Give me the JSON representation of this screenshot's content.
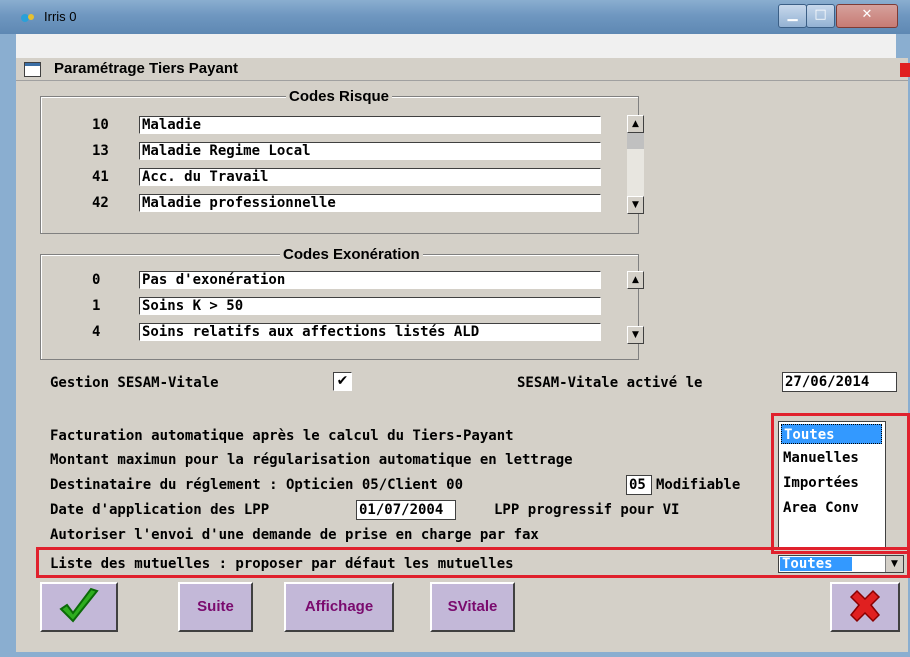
{
  "window": {
    "title": "Irris 0"
  },
  "dialog": {
    "title": "Paramétrage Tiers Payant"
  },
  "codes_risque": {
    "title": "Codes Risque",
    "items": [
      {
        "code": "10",
        "label": "Maladie"
      },
      {
        "code": "13",
        "label": "Maladie Regime Local"
      },
      {
        "code": "41",
        "label": "Acc. du Travail"
      },
      {
        "code": "42",
        "label": "Maladie professionnelle"
      }
    ]
  },
  "codes_exoneration": {
    "title": "Codes Exonération",
    "items": [
      {
        "code": "0",
        "label": "Pas d'exonération"
      },
      {
        "code": "1",
        "label": "Soins K > 50"
      },
      {
        "code": "4",
        "label": "Soins relatifs aux affections listés ALD"
      }
    ]
  },
  "sesam": {
    "label": "Gestion SESAM-Vitale",
    "checked": "✔",
    "active_label": "SESAM-Vitale activé le",
    "active_date": "27/06/2014"
  },
  "settings": {
    "line1": "Facturation automatique après le calcul du Tiers-Payant",
    "line2": "Montant maximun pour la régularisation automatique en lettrage",
    "line3_prefix": "Destinataire du réglement : Opticien 05/Client 00",
    "line3_value": "05",
    "line3_suffix": "Modifiable",
    "line4_prefix": "Date d'application des LPP",
    "line4_date": "01/07/2004",
    "line4_suffix": "LPP progressif pour VI",
    "line5": "Autoriser l'envoi d'une demande de prise en charge par fax",
    "line6": "Liste des mutuelles : proposer par défaut les mutuelles"
  },
  "listbox": {
    "options": [
      "Toutes",
      "Manuelles",
      "Importées",
      "Area Conv"
    ],
    "selected": "Toutes"
  },
  "combo": {
    "value": "Toutes"
  },
  "buttons": {
    "suite": "Suite",
    "affichage": "Affichage",
    "svitale": "SVitale"
  },
  "colors": {
    "accent_red": "#e0212d",
    "selection_blue": "#3399ff",
    "button_bg": "#c3b8d8",
    "button_text": "#7a0a6e"
  }
}
